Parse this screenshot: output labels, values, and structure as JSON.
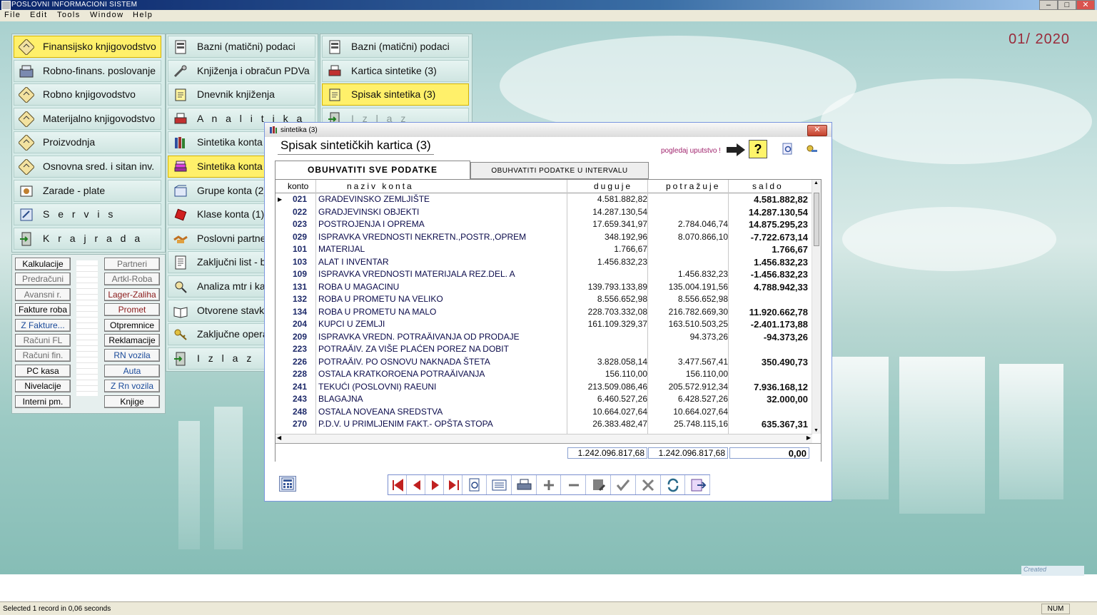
{
  "app": {
    "title": "POSLOVNI INFORMACIONI SISTEM",
    "menu": [
      "File",
      "Edit",
      "Tools",
      "Window",
      "Help"
    ],
    "period": "01/ 2020",
    "created_text": "Created",
    "status": "Selected 1 record in 0,06 seconds",
    "num_indicator": "NUM"
  },
  "menu1": [
    {
      "label": "Finansijsko knjigovodstvo",
      "icon": "ledger-diamond-icon",
      "selected": true
    },
    {
      "label": "Robno-finans. poslovanje",
      "icon": "cash-register-icon"
    },
    {
      "label": "Robno knjigovodstvo",
      "icon": "ledger-diamond-icon"
    },
    {
      "label": "Materijalno knjigovodstvo",
      "icon": "ledger-diamond-icon"
    },
    {
      "label": "Proizvodnja",
      "icon": "ledger-diamond-icon"
    },
    {
      "label": "Osnovna sred. i sitan inv.",
      "icon": "ledger-diamond-icon"
    },
    {
      "label": "Zarade - plate",
      "icon": "payroll-icon"
    },
    {
      "label": "S e r v i s",
      "icon": "service-icon"
    },
    {
      "label": "K r a j   r a d a",
      "icon": "exit-door-icon"
    }
  ],
  "shortcuts_left": [
    "Kalkulacije",
    "Predračuni",
    "Avansni r.",
    "Fakture roba",
    "Z Fakture...",
    "Računi FL",
    "Računi fin.",
    "PC kasa",
    "Nivelacije",
    "Interni pm."
  ],
  "shortcuts_right": [
    "Partneri",
    "Artkl-Roba",
    "Lager-Zaliha",
    "Promet",
    "Otpremnice",
    "Reklamacije",
    "RN vozila",
    "Auta",
    "Z Rn vozila",
    "Knjige"
  ],
  "menu2": [
    {
      "label": "Bazni (matični) podaci",
      "icon": "database-icon"
    },
    {
      "label": "Knjiženja i obračun PDVa",
      "icon": "tools-icon"
    },
    {
      "label": "Dnevnik knjiženja",
      "icon": "notepad-icon"
    },
    {
      "label": "A n a l i t i k a",
      "icon": "printer-icon"
    },
    {
      "label": "Sintetika konta",
      "icon": "books-icon"
    },
    {
      "label": "Sintetika konta",
      "icon": "book-stack-icon",
      "selected": true
    },
    {
      "label": "Grupe konta (2)",
      "icon": "folder-book-icon"
    },
    {
      "label": "Klase konta (1)",
      "icon": "red-book-icon"
    },
    {
      "label": "Poslovni partneri",
      "icon": "handshake-icon"
    },
    {
      "label": "Zaključni list - b",
      "icon": "document-list-icon"
    },
    {
      "label": "Analiza mtr i ka",
      "icon": "analysis-icon"
    },
    {
      "label": "Otvorene stavke",
      "icon": "open-book-icon"
    },
    {
      "label": "Zaključne opera",
      "icon": "keys-icon"
    },
    {
      "label": "I z l a z",
      "icon": "exit-door-icon"
    }
  ],
  "menu3": [
    {
      "label": "Bazni (matični) podaci",
      "icon": "database-icon"
    },
    {
      "label": "Kartica sintetike (3)",
      "icon": "printer-icon"
    },
    {
      "label": "Spisak sintetika (3)",
      "icon": "notepad-icon",
      "selected": true
    },
    {
      "label": "I z l a z",
      "icon": "exit-door-icon",
      "disabled": true
    }
  ],
  "dialog": {
    "caption": "sintetika (3)",
    "title": "Spisak sintetičkih kartica (3)",
    "help": "pogledaj uputstvo !",
    "tabs": [
      "OBUHVATITI  SVE  PODATKE",
      "OBUHVATITI  PODATKE  U  INTERVALU"
    ],
    "columns": {
      "konto": "konto",
      "naziv": "naziv  konta",
      "duguje": "duguje",
      "potrazuje": "potražuje",
      "saldo": "saldo"
    },
    "rows": [
      {
        "konto": "021",
        "naziv": "GRADEVINSKO ZEMLJIŠTE",
        "duguje": "4.581.882,82",
        "potrazuje": "",
        "saldo": "4.581.882,82",
        "current": true
      },
      {
        "konto": "022",
        "naziv": "GRADJEVINSKI OBJEKTI",
        "duguje": "14.287.130,54",
        "potrazuje": "",
        "saldo": "14.287.130,54"
      },
      {
        "konto": "023",
        "naziv": "POSTROJENJA I OPREMA",
        "duguje": "17.659.341,97",
        "potrazuje": "2.784.046,74",
        "saldo": "14.875.295,23"
      },
      {
        "konto": "029",
        "naziv": "ISPRAVKA VREDNOSTI NEKRETN.,POSTR.,OPREM",
        "duguje": "348.192,96",
        "potrazuje": "8.070.866,10",
        "saldo": "-7.722.673,14"
      },
      {
        "konto": "101",
        "naziv": "MATERIJAL",
        "duguje": "1.766,67",
        "potrazuje": "",
        "saldo": "1.766,67"
      },
      {
        "konto": "103",
        "naziv": "ALAT I INVENTAR",
        "duguje": "1.456.832,23",
        "potrazuje": "",
        "saldo": "1.456.832,23"
      },
      {
        "konto": "109",
        "naziv": "ISPRAVKA VREDNOSTI MATERIJALA REZ.DEL. A",
        "duguje": "",
        "potrazuje": "1.456.832,23",
        "saldo": "-1.456.832,23"
      },
      {
        "konto": "131",
        "naziv": "ROBA U MAGACINU",
        "duguje": "139.793.133,89",
        "potrazuje": "135.004.191,56",
        "saldo": "4.788.942,33"
      },
      {
        "konto": "132",
        "naziv": "ROBA U PROMETU NA VELIKO",
        "duguje": "8.556.652,98",
        "potrazuje": "8.556.652,98",
        "saldo": ""
      },
      {
        "konto": "134",
        "naziv": "ROBA U PROMETU NA MALO",
        "duguje": "228.703.332,08",
        "potrazuje": "216.782.669,30",
        "saldo": "11.920.662,78"
      },
      {
        "konto": "204",
        "naziv": "KUPCI U ZEMLJI",
        "duguje": "161.109.329,37",
        "potrazuje": "163.510.503,25",
        "saldo": "-2.401.173,88"
      },
      {
        "konto": "209",
        "naziv": "ISPRAVKA VREDN. POTRAÄIVANJA OD PRODAJE",
        "duguje": "",
        "potrazuje": "94.373,26",
        "saldo": "-94.373,26"
      },
      {
        "konto": "223",
        "naziv": "POTRAÄIV. ZA VIŠE PLAĆEN POREZ NA DOBIT",
        "duguje": "",
        "potrazuje": "",
        "saldo": ""
      },
      {
        "konto": "226",
        "naziv": "POTRAÄIV. PO OSNOVU NAKNADA ŠTETA",
        "duguje": "3.828.058,14",
        "potrazuje": "3.477.567,41",
        "saldo": "350.490,73"
      },
      {
        "konto": "228",
        "naziv": "OSTALA KRATKOROENA POTRAÄIVANJA",
        "duguje": "156.110,00",
        "potrazuje": "156.110,00",
        "saldo": ""
      },
      {
        "konto": "241",
        "naziv": "TEKUĆI (POSLOVNI) RAEUNI",
        "duguje": "213.509.086,46",
        "potrazuje": "205.572.912,34",
        "saldo": "7.936.168,12"
      },
      {
        "konto": "243",
        "naziv": "BLAGAJNA",
        "duguje": "6.460.527,26",
        "potrazuje": "6.428.527,26",
        "saldo": "32.000,00"
      },
      {
        "konto": "248",
        "naziv": "OSTALA NOVEANA SREDSTVA",
        "duguje": "10.664.027,64",
        "potrazuje": "10.664.027,64",
        "saldo": ""
      },
      {
        "konto": "270",
        "naziv": "P.D.V. U PRIMLJENIM FAKT.- OPŠTA STOPA",
        "duguje": "26.383.482,47",
        "potrazuje": "25.748.115,16",
        "saldo": "635.367,31"
      }
    ],
    "totals": {
      "duguje": "1.242.096.817,68",
      "potrazuje": "1.242.096.817,68",
      "saldo": "0,00"
    },
    "nav_buttons": [
      "first-record-icon",
      "prev-record-icon",
      "next-record-icon",
      "last-record-icon",
      "search-icon",
      "list-view-icon",
      "print-icon",
      "add-icon",
      "delete-icon",
      "edit-icon",
      "confirm-icon",
      "cancel-icon",
      "refresh-icon",
      "exit-icon"
    ]
  }
}
